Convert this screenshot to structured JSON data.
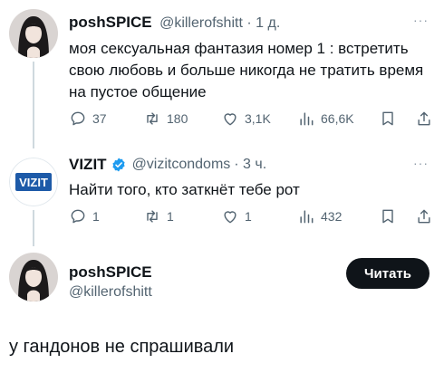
{
  "tweets": [
    {
      "name": "poshSPICE",
      "handle": "@killerofshitt",
      "time": "· 1 д.",
      "text": "моя сексуальная фантазия номер 1 : встретить свою любовь и больше никогда не тратить время на пустое общение",
      "replies": "37",
      "retweets": "180",
      "likes": "3,1K",
      "views": "66,6K",
      "more": "···"
    },
    {
      "name": "VIZIT",
      "handle": "@vizitcondoms",
      "time": "· 3 ч.",
      "logo_text": "VIZIT",
      "text": "Найти того, кто заткнёт тебе рот",
      "replies": "1",
      "retweets": "1",
      "likes": "1",
      "views": "432",
      "more": "···",
      "brand_color": "#1d5aa8"
    }
  ],
  "main": {
    "name": "poshSPICE",
    "handle": "@killerofshitt",
    "follow_label": "Читать",
    "text": "у гандонов не спрашивали"
  },
  "colors": {
    "verified": "#1d9bf0",
    "muted": "#536471",
    "line": "#cfd9de"
  }
}
